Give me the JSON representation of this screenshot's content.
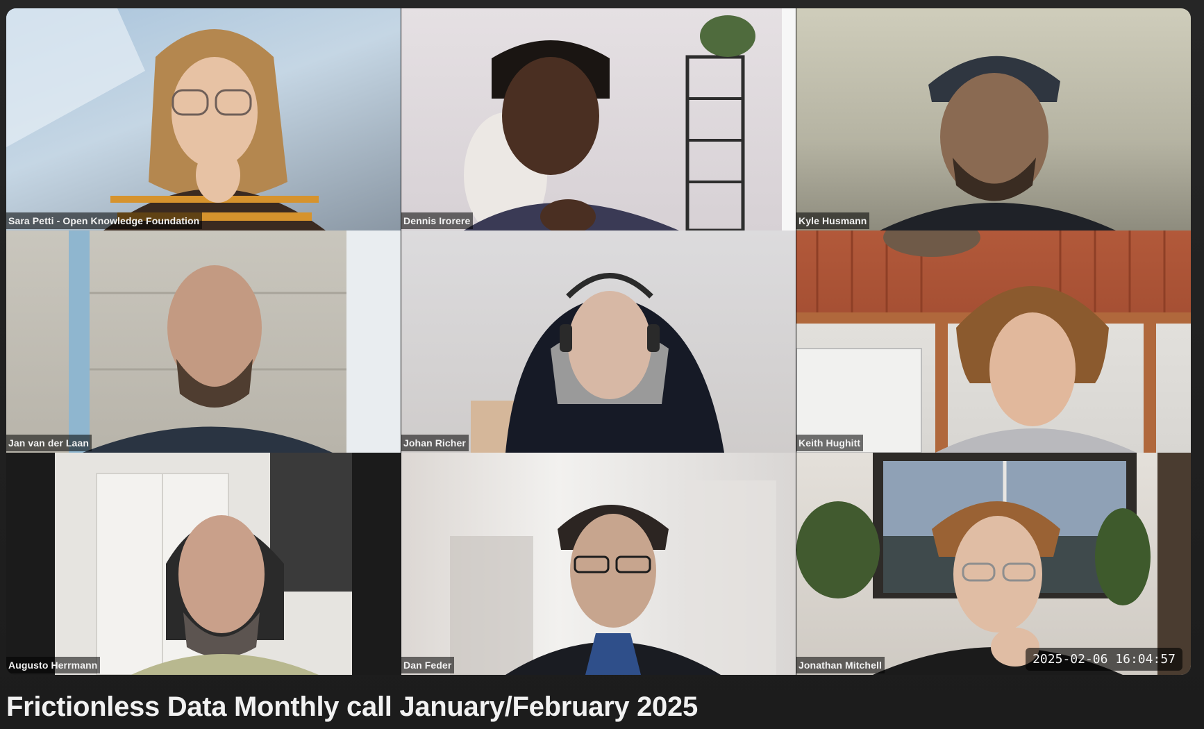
{
  "video_title": "Frictionless Data Monthly call January/February 2025",
  "timestamp": "2025-02-06 16:04:57",
  "participants": [
    {
      "name": "Sara Petti - Open Knowledge Foundation"
    },
    {
      "name": "Dennis Irorere"
    },
    {
      "name": "Kyle Husmann"
    },
    {
      "name": "Jan van der Laan"
    },
    {
      "name": "Johan Richer"
    },
    {
      "name": "Keith Hughitt"
    },
    {
      "name": "Augusto Herrmann"
    },
    {
      "name": "Dan Feder"
    },
    {
      "name": "Jonathan Mitchell"
    }
  ]
}
